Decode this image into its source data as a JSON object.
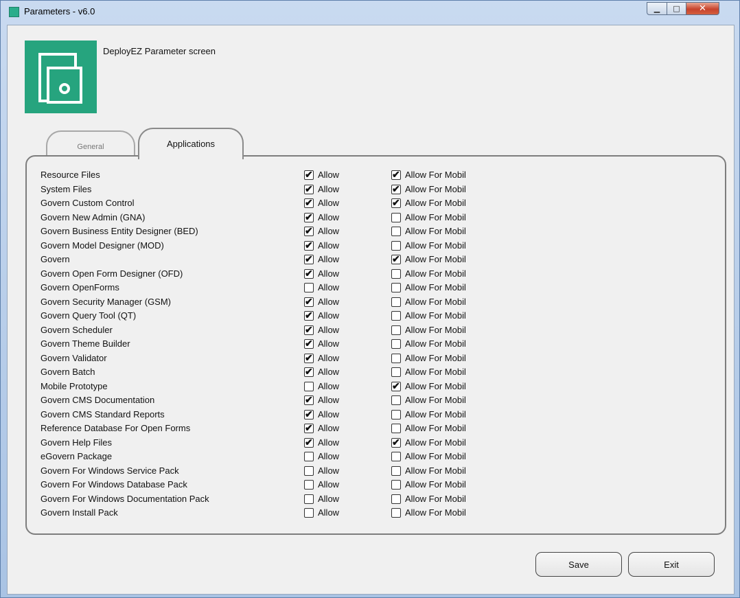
{
  "window": {
    "title": "Parameters -  v6.0"
  },
  "header": {
    "text": "DeployEZ Parameter screen"
  },
  "tabs": [
    {
      "label": "General"
    },
    {
      "label": "Applications"
    }
  ],
  "columns": {
    "allow": "Allow",
    "mobile": "Allow For Mobil"
  },
  "rows": [
    {
      "name": "Resource Files",
      "allow": true,
      "mobile": true
    },
    {
      "name": "System Files",
      "allow": true,
      "mobile": true
    },
    {
      "name": "Govern Custom Control",
      "allow": true,
      "mobile": true
    },
    {
      "name": "Govern New Admin (GNA)",
      "allow": true,
      "mobile": false
    },
    {
      "name": "Govern Business Entity Designer (BED)",
      "allow": true,
      "mobile": false
    },
    {
      "name": "Govern Model Designer (MOD)",
      "allow": true,
      "mobile": false
    },
    {
      "name": "Govern",
      "allow": true,
      "mobile": true
    },
    {
      "name": "Govern Open Form Designer (OFD)",
      "allow": true,
      "mobile": false
    },
    {
      "name": "Govern OpenForms",
      "allow": false,
      "mobile": false
    },
    {
      "name": "Govern Security Manager (GSM)",
      "allow": true,
      "mobile": false
    },
    {
      "name": "Govern Query Tool (QT)",
      "allow": true,
      "mobile": false
    },
    {
      "name": "Govern Scheduler",
      "allow": true,
      "mobile": false
    },
    {
      "name": "Govern Theme Builder",
      "allow": true,
      "mobile": false
    },
    {
      "name": "Govern Validator",
      "allow": true,
      "mobile": false
    },
    {
      "name": "Govern Batch",
      "allow": true,
      "mobile": false
    },
    {
      "name": "Mobile Prototype",
      "allow": false,
      "mobile": true
    },
    {
      "name": "Govern CMS Documentation",
      "allow": true,
      "mobile": false
    },
    {
      "name": "Govern CMS Standard Reports",
      "allow": true,
      "mobile": false
    },
    {
      "name": "Reference Database For Open Forms",
      "allow": true,
      "mobile": false
    },
    {
      "name": "Govern Help Files",
      "allow": true,
      "mobile": true
    },
    {
      "name": "eGovern Package",
      "allow": false,
      "mobile": false
    },
    {
      "name": "Govern For Windows Service Pack",
      "allow": false,
      "mobile": false
    },
    {
      "name": "Govern For Windows Database Pack",
      "allow": false,
      "mobile": false
    },
    {
      "name": "Govern For Windows Documentation Pack",
      "allow": false,
      "mobile": false
    },
    {
      "name": "Govern Install Pack",
      "allow": false,
      "mobile": false
    }
  ],
  "buttons": {
    "save": "Save",
    "exit": "Exit"
  },
  "colors": {
    "logo": "#26a47e",
    "close_button": "#c7432c"
  }
}
